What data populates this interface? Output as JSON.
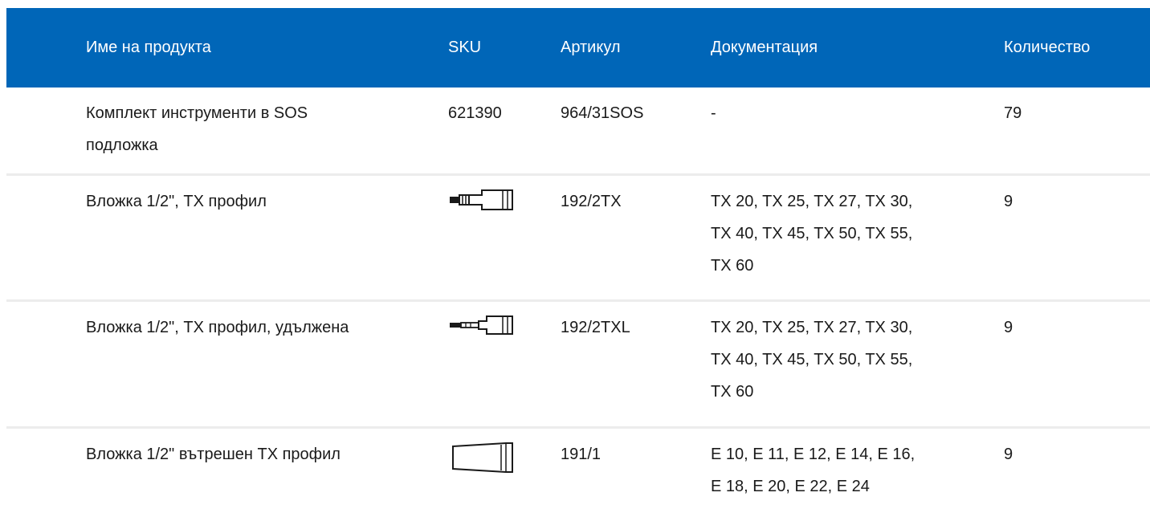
{
  "columns": {
    "name": "Име на продукта",
    "sku": "SKU",
    "article": "Артикул",
    "documentation": "Документация",
    "quantity": "Количество"
  },
  "rows": [
    {
      "name_lines": [
        "Комплект инструменти в SOS",
        "подложка"
      ],
      "sku": "621390",
      "sku_icon": null,
      "article": "964/31SOS",
      "doc_lines": [
        "-"
      ],
      "quantity": "79"
    },
    {
      "name_lines": [
        "Вложка 1/2\", TX профил"
      ],
      "sku": "",
      "sku_icon": "tx-bit-socket-icon",
      "article": "192/2TX",
      "doc_lines": [
        "TX 20, TX 25, TX 27, TX 30,",
        "TX 40, TX 45, TX 50, TX 55,",
        "TX 60"
      ],
      "quantity": "9"
    },
    {
      "name_lines": [
        "Вложка 1/2\", TX профил, удължена"
      ],
      "sku": "",
      "sku_icon": "long-tx-bit-socket-icon",
      "article": "192/2TXL",
      "doc_lines": [
        "TX 20, TX 25, TX 27, TX 30,",
        "TX 40, TX 45, TX 50, TX 55,",
        "TX 60"
      ],
      "quantity": "9"
    },
    {
      "name_lines": [
        "Вложка 1/2\" вътрешен TX профил"
      ],
      "sku": "",
      "sku_icon": "e-torx-socket-icon",
      "article": "191/1",
      "doc_lines": [
        "E 10, E 11, E 12, E 14, E 16,",
        "E 18, E 20, E 22, E 24"
      ],
      "quantity": "9"
    }
  ]
}
